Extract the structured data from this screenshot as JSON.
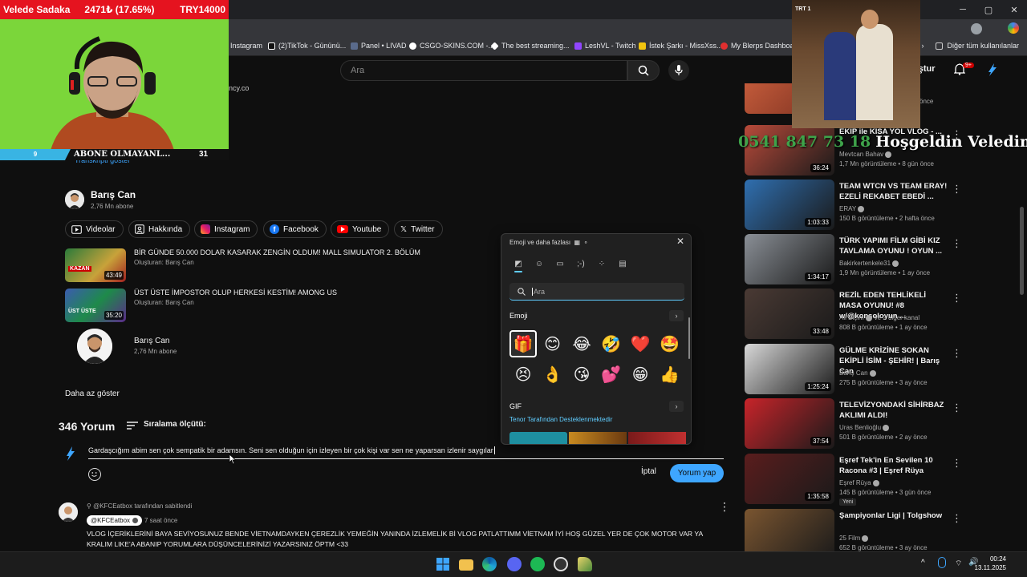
{
  "webcam": {
    "streamer": "Velede Sadaka",
    "ticker": "2471₺ (17.65%)",
    "goal": "TRY14000",
    "left_badge": "9",
    "marquee": "ABONE OLMAYANL...",
    "count": "31"
  },
  "browser": {
    "bookmarks": [
      "Instagram",
      "(2)TikTok - Gününü...",
      "Panel • LIVAD",
      "CSGO-SKINS.COM -...",
      "The best streaming...",
      "LeshVL - Twitch",
      "İstek Şarkı - MissXss...",
      "My Blerps Dashboard"
    ],
    "bookmarks_more": "Diğer tüm kullanılanlar"
  },
  "youtube": {
    "search_placeholder": "Ara",
    "create_label": "uştur",
    "notif_count": "9+"
  },
  "overlay": {
    "phone": "0541 847 73 18",
    "text": "Hoşgeldin Veledim"
  },
  "description": {
    "link_fragment": "ncy.co",
    "transcript_fragment": "Transkripti göster"
  },
  "channel": {
    "name": "Barış Can",
    "subs": "2,76 Mn abone",
    "chips": [
      "Videolar",
      "Hakkında",
      "Instagram",
      "Facebook",
      "Youtube",
      "Twitter"
    ]
  },
  "featured_videos": [
    {
      "title": "BİR GÜNDE 50.000 DOLAR KASARAK ZENGİN OLDUM! MALL SIMULATOR 2. BÖLÜM",
      "by": "Oluşturan: Barış Can",
      "duration": "43:49"
    },
    {
      "title": "ÜST ÜSTE İMPOSTOR OLUP HERKESİ KESTİM! AMONG US",
      "by": "Oluşturan: Barış Can",
      "duration": "35:20"
    }
  ],
  "channel_card": {
    "name": "Barış Can",
    "subs": "2,76 Mn abone"
  },
  "show_less": "Daha az göster",
  "comments": {
    "count": "346 Yorum",
    "sort_label": "Sıralama ölçütü:",
    "draft": "Gardaşcığım abim sen çok sempatik bir adamsın. Seni sen olduğun için izleyen bir çok kişi var sen ne yaparsan izlenir saygılar",
    "cancel": "İptal",
    "submit": "Yorum yap",
    "pinned": {
      "pinned_label": "@KFCEatbox tarafından sabitlendi",
      "author": "@KFCEatbox",
      "time": "7 saat önce",
      "text": "VLOG İÇERİKLERİNİ BAYA SEVİYOSUNUZ BENDE VİETNAMDAYKEN ÇEREZLİK YEMEĞİN YANINDA İZLEMELİK Bİ VLOG PATLATTIMM VİETNAM İYİ HOŞ GÜZEL YER DE ÇOK MOTOR VAR YA KRALIM LIKE'A ABANIP YORUMLARA DÜŞÜNCELERİNİZİ YAZARSINIZ ÖPTM <33"
    }
  },
  "emoji_panel": {
    "title": "Emoji ve daha fazlası",
    "search_placeholder": "Ara",
    "emoji_header": "Emoji",
    "gif_header": "GIF",
    "tenor": "Tenor Tarafından Desteklenmektedir",
    "emojis": [
      "🎁",
      "😊",
      "😂",
      "🤣",
      "❤️",
      "🤩",
      "😣",
      "👌",
      "😘",
      "💕",
      "😁",
      "👍"
    ]
  },
  "sidebar": {
    "top_partial_meta": "önce",
    "videos": [
      {
        "title": "EKİP ile KISA YOL VLOG - ...",
        "channel": "Mevtcan Bahav",
        "meta": "1,7 Mn görüntüleme • 8 gün önce",
        "duration": "36:24",
        "color": "#b84a3a"
      },
      {
        "title": "TEAM WTCN VS TEAM ERAY! EZELİ REKABET EBEDİ ...",
        "channel": "ERAY",
        "meta": "150 B görüntüleme • 2 hafta önce",
        "duration": "1:03:33",
        "color": "#2f6fb0"
      },
      {
        "title": "TÜRK YAPIMI FİLM GİBİ KIZ TAVLAMA OYUNU ! OYUN ...",
        "channel": "Bakirkertenkele31",
        "meta": "1,9 Mn görüntüleme • 1 ay önce",
        "duration": "1:34:17",
        "color": "#8a8f96"
      },
      {
        "title": "REZİL EDEN TEHLİKELİ MASA OYUNU! #8 w/@konsoloyun ...",
        "channel": "Ali Biçim",
        "meta": "808 B görüntüleme • 1 ay önce",
        "duration": "33:48",
        "color": "#4a3a34",
        "extra": "ve 2 diğer kanal"
      },
      {
        "title": "GÜLME KRİZİNE SOKAN EKİPLİ İSİM - ŞEHİR! | Barış Can",
        "channel": "Barış Can",
        "meta": "275 B görüntüleme • 3 ay önce",
        "duration": "1:25:24",
        "color": "#d8d8d8"
      },
      {
        "title": "TELEVİZYONDAKİ SİHİRBAZ AKLIMI ALDI!",
        "channel": "Uras Benlioğlu",
        "meta": "501 B görüntüleme • 2 ay önce",
        "duration": "37:54",
        "color": "#c8242a"
      },
      {
        "title": "Eşref Tek'in En Sevilen 10 Racona #3 | Eşref Rüya",
        "channel": "Eşref Rüya",
        "meta": "145 B görüntüleme • 3 gün önce",
        "duration": "1:35:58",
        "color": "#5a1d1d",
        "badge": "Yeni"
      },
      {
        "title": "Şampiyonlar Ligi | Tolgshow",
        "channel": "25 Film",
        "meta": "652 B görüntüleme • 3 ay önce",
        "duration": "",
        "color": "#7a5530"
      }
    ]
  },
  "taskbar": {
    "time": "00:24",
    "date": "13.11.2025"
  }
}
